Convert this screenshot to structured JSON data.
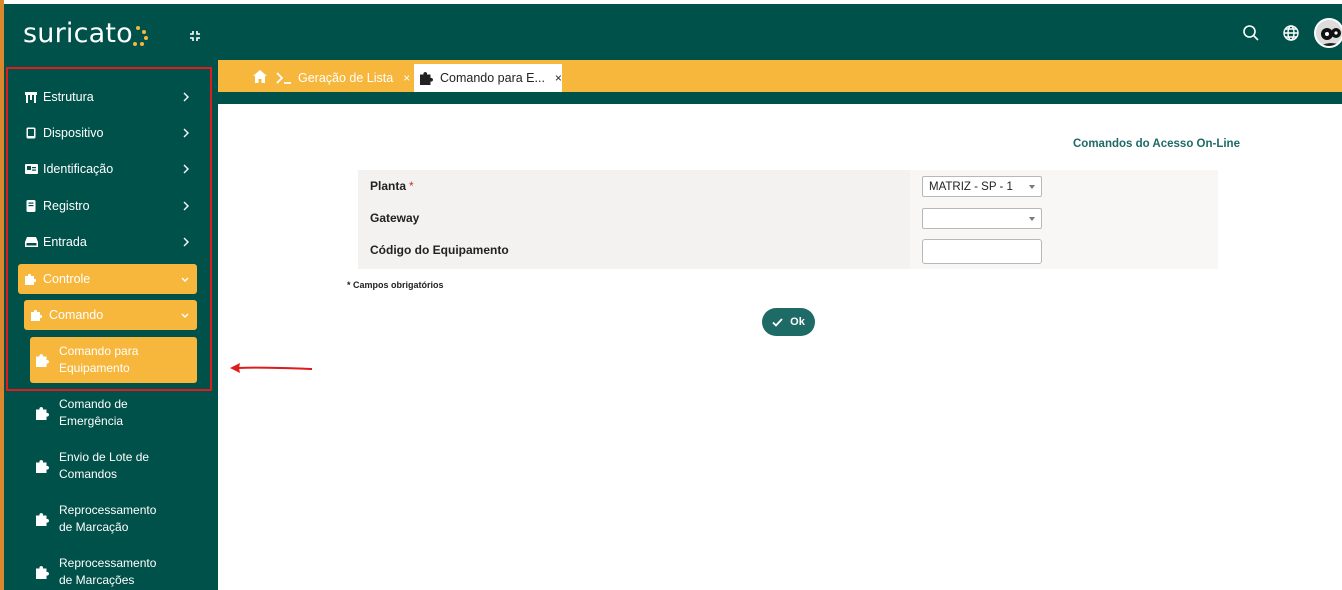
{
  "app": {
    "logo_text": "suricato",
    "brand_green": "#00514a",
    "accent_orange": "#f6b73c",
    "annotation_red": "#e01b1b"
  },
  "sidebar": {
    "items": [
      {
        "label": "Estrutura",
        "icon": "building-icon"
      },
      {
        "label": "Dispositivo",
        "icon": "tablet-icon"
      },
      {
        "label": "Identificação",
        "icon": "id-card-icon"
      },
      {
        "label": "Registro",
        "icon": "book-icon"
      },
      {
        "label": "Entrada",
        "icon": "drive-icon"
      },
      {
        "label": "Controle",
        "icon": "puzzle-icon",
        "active": true
      }
    ],
    "sub_group": {
      "label": "Comando",
      "icon": "puzzle-icon"
    },
    "sub_items": [
      {
        "line1": "Comando para",
        "line2": "Equipamento",
        "active": true
      },
      {
        "line1": "Comando de",
        "line2": "Emergência"
      },
      {
        "line1": "Envio de Lote de",
        "line2": "Comandos"
      },
      {
        "line1": "Reprocessamento",
        "line2": "de Marcação"
      },
      {
        "line1": "Reprocessamento",
        "line2": "de Marcações"
      }
    ]
  },
  "tabs": {
    "items": [
      {
        "label": "Geração de Lista",
        "icon": "terminal-icon",
        "close": "×"
      },
      {
        "label": "Comando para E...",
        "icon": "puzzle-icon",
        "close": "×",
        "active": true
      }
    ]
  },
  "form": {
    "title": "Comandos do Acesso On-Line",
    "fields": [
      {
        "label": "Planta",
        "required_mark": "*",
        "type": "select",
        "value": "MATRIZ - SP - 1"
      },
      {
        "label": "Gateway",
        "required_mark": "",
        "type": "select",
        "value": ""
      },
      {
        "label": "Código do Equipamento",
        "required_mark": "",
        "type": "input",
        "value": ""
      }
    ],
    "required_note": "* Campos obrigatórios",
    "ok_label": "Ok"
  }
}
